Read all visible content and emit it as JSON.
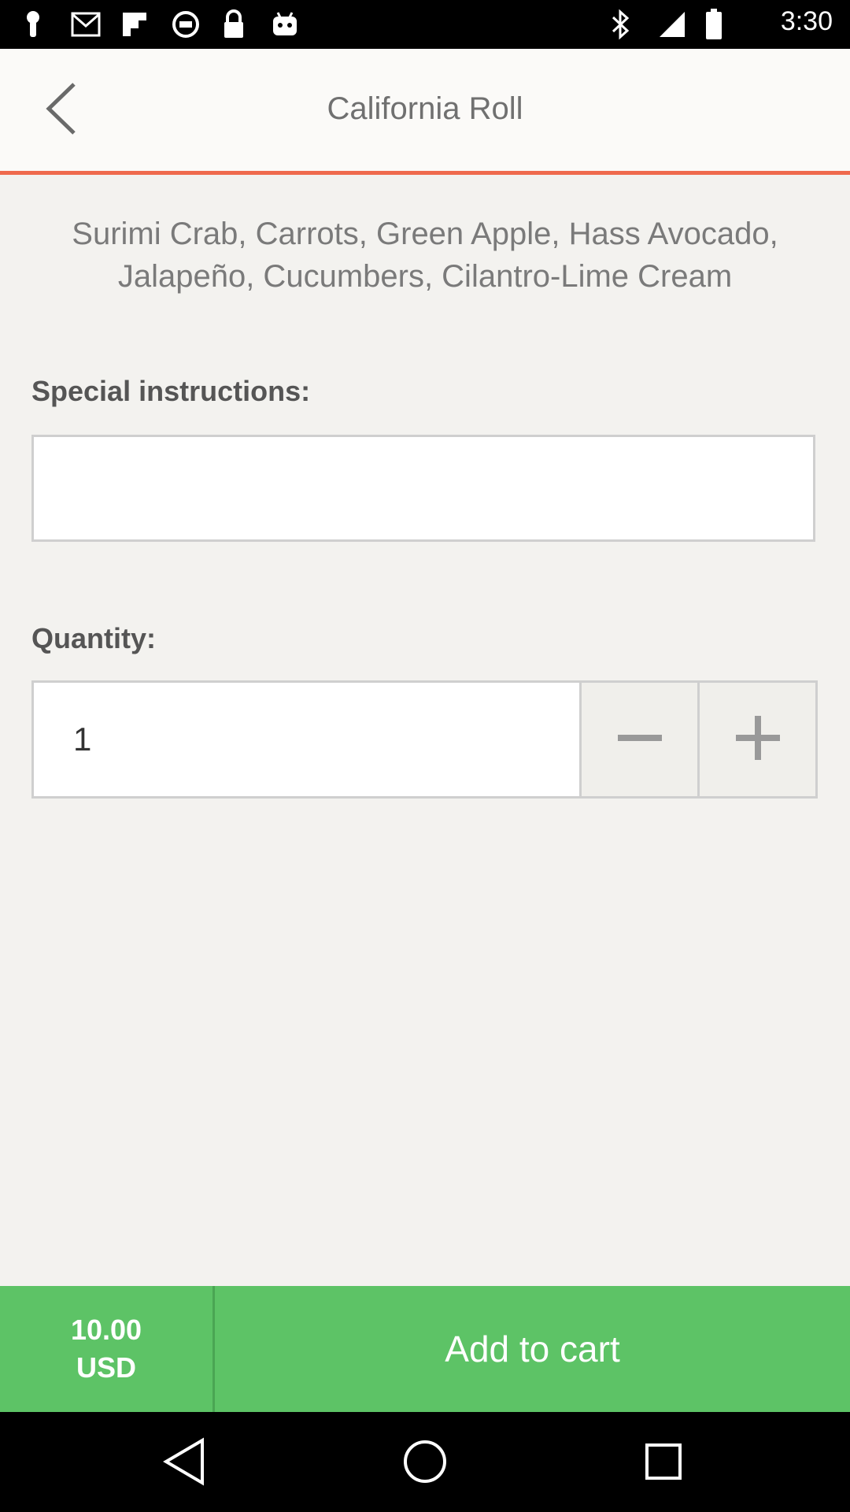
{
  "status_bar": {
    "time": "3:30",
    "icons": [
      "notification-icon",
      "gmail-icon",
      "flipboard-icon",
      "sync-icon",
      "lock-icon",
      "android-icon",
      "bluetooth-icon"
    ]
  },
  "header": {
    "title": "California Roll",
    "back_icon": "back-arrow-icon",
    "accent_color": "#ef6a4d"
  },
  "item": {
    "description": "Surimi Crab, Carrots, Green Apple, Hass Avocado, Jalapeño, Cucumbers, Cilantro-Lime Cream"
  },
  "instructions": {
    "label": "Special instructions:",
    "value": "",
    "placeholder": ""
  },
  "quantity": {
    "label": "Quantity:",
    "value": "1",
    "decrement_icon": "minus-icon",
    "increment_icon": "plus-icon"
  },
  "footer": {
    "price": "10.00",
    "currency": "USD",
    "add_label": "Add to cart",
    "accent_color": "#5dc366"
  },
  "nav_bar": {
    "icons": [
      "back-nav-icon",
      "home-nav-icon",
      "recents-nav-icon"
    ]
  }
}
